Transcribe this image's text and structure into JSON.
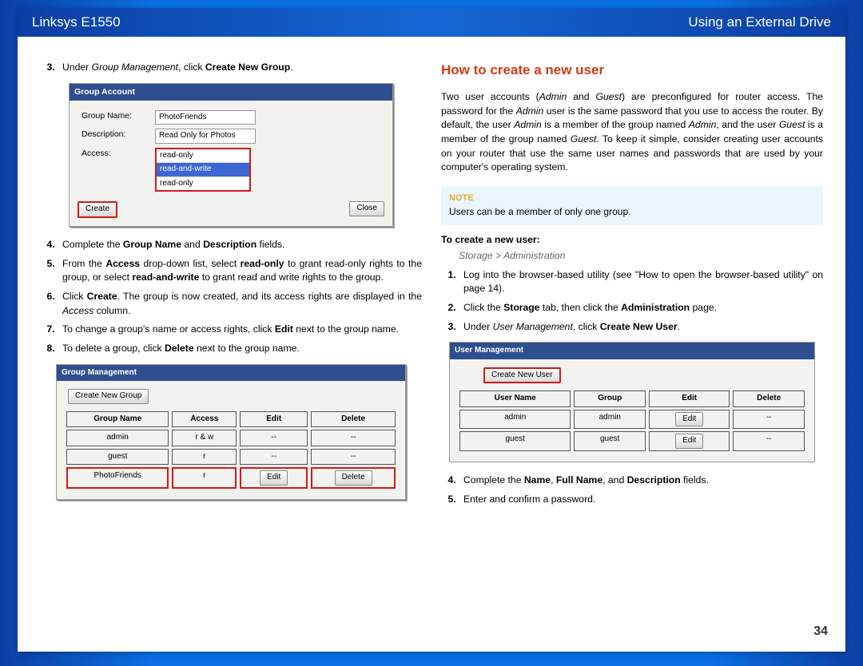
{
  "header": {
    "left": "Linksys E1550",
    "right": "Using an External Drive"
  },
  "left": {
    "steps_a": [
      {
        "n": "3.",
        "html": "Under <span class=\"em\">Group Management</span>, click <b>Create New Group</b>."
      }
    ],
    "group_account": {
      "title": "Group Account",
      "rows": [
        {
          "label": "Group Name:",
          "value": "PhotoFriends"
        },
        {
          "label": "Description:",
          "value": "Read Only for Photos"
        },
        {
          "label": "Access:",
          "select": [
            "read-only",
            "read-and-write",
            "read-only"
          ],
          "active": 1
        }
      ],
      "create": "Create",
      "close": "Close"
    },
    "steps_b": [
      {
        "n": "4.",
        "html": "Complete the <b>Group Name</b> and <b>Description</b> fields."
      },
      {
        "n": "5.",
        "html": "From the <b>Access</b> drop-down list, select <b>read-only</b> to grant read-only rights to the group, or select <b>read-and-write</b> to grant read and write rights to the group."
      },
      {
        "n": "6.",
        "html": "Click <b>Create</b>. The group is now created, and its access rights are displayed in the <span class=\"em\">Access</span> column."
      },
      {
        "n": "7.",
        "html": "To change a group's name or access rights, click <b>Edit</b> next to the group name."
      },
      {
        "n": "8.",
        "html": "To delete a group, click <b>Delete</b> next to the group name."
      }
    ],
    "group_mgmt": {
      "title": "Group Management",
      "newBtn": "Create New Group",
      "headers": [
        "Group Name",
        "Access",
        "Edit",
        "Delete"
      ],
      "rows": [
        {
          "name": "admin",
          "access": "r & w",
          "edit": "--",
          "delete": "--",
          "hl": false
        },
        {
          "name": "guest",
          "access": "r",
          "edit": "--",
          "delete": "--",
          "hl": false
        },
        {
          "name": "PhotoFriends",
          "access": "r",
          "edit": "Edit",
          "delete": "Delete",
          "hl": true
        }
      ]
    }
  },
  "right": {
    "heading": "How to create a new user",
    "intro": "Two user accounts (<span class=\"em\">Admin</span> and <span class=\"em\">Guest</span>) are preconfigured for router access. The password for the <span class=\"em\">Admin</span> user is the same password that you use to access the router. By default, the user <span class=\"em\">Admin</span> is a member of the group named <span class=\"em\">Admin</span>, and the user <span class=\"em\">Guest</span> is a member of the group named <span class=\"em\">Guest</span>. To keep it simple, consider creating user accounts on your router that use the same user names and passwords that are used by your computer's operating system.",
    "note": {
      "label": "Note",
      "text": "Users can be a member of only one group."
    },
    "subhead": "To create a new user:",
    "breadcrumb": "Storage > Administration",
    "steps": [
      {
        "n": "1.",
        "html": "Log into the browser-based utility (see \"How to open the browser-based utility\" on page 14)."
      },
      {
        "n": "2.",
        "html": "Click the <b>Storage</b> tab, then click the <b>Administration</b> page."
      },
      {
        "n": "3.",
        "html": "Under <span class=\"em\">User Management</span>, click <b>Create New User</b>."
      }
    ],
    "user_mgmt": {
      "title": "User Management",
      "newBtn": "Create New User",
      "headers": [
        "User Name",
        "Group",
        "Edit",
        "Delete"
      ],
      "rows": [
        {
          "name": "admin",
          "group": "admin",
          "edit": "Edit",
          "delete": "--"
        },
        {
          "name": "guest",
          "group": "guest",
          "edit": "Edit",
          "delete": "--"
        }
      ]
    },
    "steps2": [
      {
        "n": "4.",
        "html": "Complete the <b>Name</b>, <b>Full Name</b>, and <b>Description</b> fields."
      },
      {
        "n": "5.",
        "html": "Enter and confirm a password."
      }
    ]
  },
  "footer": "34"
}
